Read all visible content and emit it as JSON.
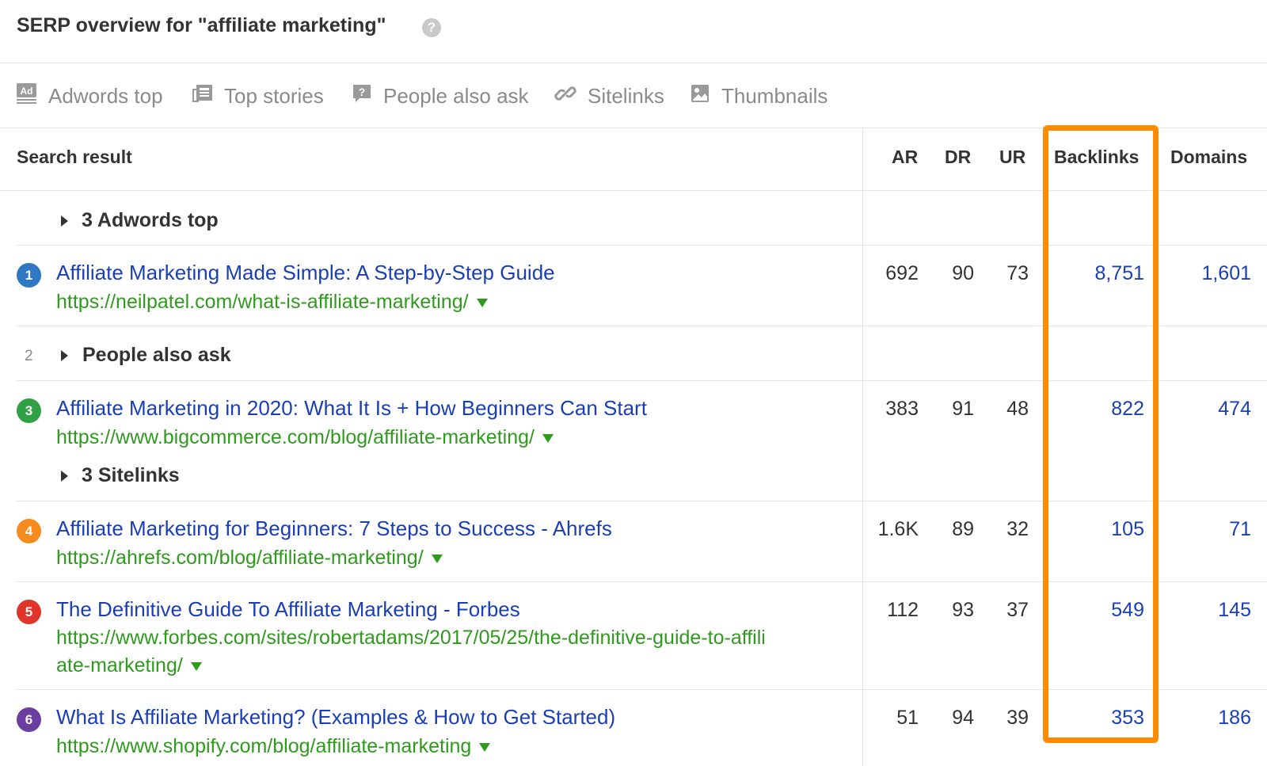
{
  "header": {
    "title": "SERP overview for \"affiliate marketing\"",
    "help_icon": "?"
  },
  "features": [
    {
      "label": "Adwords top",
      "icon": "ad-icon"
    },
    {
      "label": "Top stories",
      "icon": "news-icon"
    },
    {
      "label": "People also ask",
      "icon": "question-icon"
    },
    {
      "label": "Sitelinks",
      "icon": "link-icon"
    },
    {
      "label": "Thumbnails",
      "icon": "image-icon"
    }
  ],
  "table": {
    "headers": {
      "search_result": "Search result",
      "ar": "AR",
      "dr": "DR",
      "ur": "UR",
      "backlinks": "Backlinks",
      "domains": "Domains"
    },
    "groups": {
      "adwords": "3 Adwords top",
      "people_num": "2",
      "people": "People also ask",
      "sitelinks": "3 Sitelinks"
    },
    "results": [
      {
        "pos": "1",
        "color": "#2f78c4",
        "title": "Affiliate Marketing Made Simple: A Step-by-Step Guide",
        "url": "https://neilpatel.com/what-is-affiliate-marketing/",
        "ar": "692",
        "dr": "90",
        "ur": "73",
        "backlinks": "8,751",
        "domains": "1,601"
      },
      {
        "pos": "3",
        "color": "#2fa043",
        "title": "Affiliate Marketing in 2020: What It Is + How Beginners Can Start",
        "url": "https://www.bigcommerce.com/blog/affiliate-marketing/",
        "ar": "383",
        "dr": "91",
        "ur": "48",
        "backlinks": "822",
        "domains": "474"
      },
      {
        "pos": "4",
        "color": "#f58a1f",
        "title": "Affiliate Marketing for Beginners: 7 Steps to Success - Ahrefs",
        "url": "https://ahrefs.com/blog/affiliate-marketing/",
        "ar": "1.6K",
        "dr": "89",
        "ur": "32",
        "backlinks": "105",
        "domains": "71"
      },
      {
        "pos": "5",
        "color": "#e0352b",
        "title": "The Definitive Guide To Affiliate Marketing - Forbes",
        "url_line1": "https://www.forbes.com/sites/robertadams/2017/05/25/the-definitive-guide-to-affili",
        "url_line2": "ate-marketing/",
        "ar": "112",
        "dr": "93",
        "ur": "37",
        "backlinks": "549",
        "domains": "145"
      },
      {
        "pos": "6",
        "color": "#6a3fa0",
        "title": "What Is Affiliate Marketing? (Examples & How to Get Started)",
        "url": "https://www.shopify.com/blog/affiliate-marketing",
        "ar": "51",
        "dr": "94",
        "ur": "39",
        "backlinks": "353",
        "domains": "186"
      }
    ]
  },
  "colors": {
    "highlight": "#ff8c00",
    "link": "#1a3fb5",
    "url": "#2f9a1e"
  }
}
